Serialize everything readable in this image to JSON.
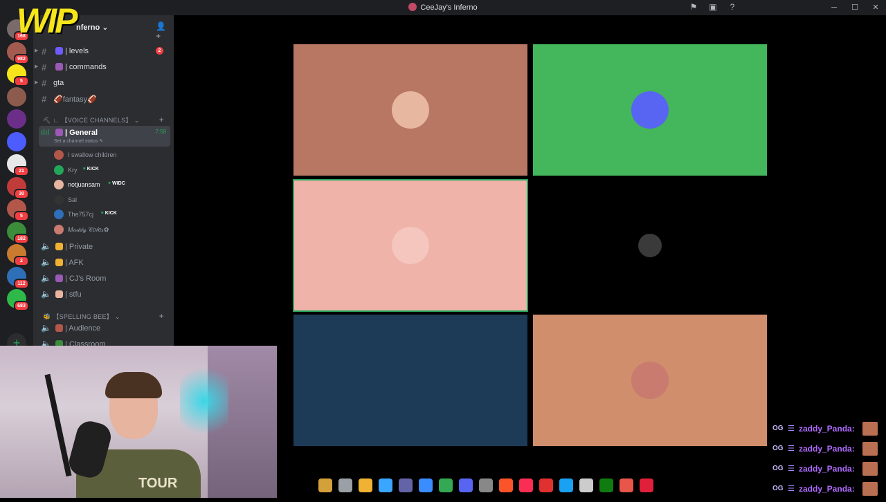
{
  "window": {
    "title": "CeeJay's Inferno",
    "icons": [
      "inbox-icon",
      "screen-share-icon",
      "help-icon"
    ],
    "controls": [
      "minimize",
      "maximize",
      "close"
    ]
  },
  "server_rail": {
    "servers": [
      {
        "name": "server-1",
        "color": "#7a6a6a",
        "badge": "168"
      },
      {
        "name": "server-2",
        "color": "#a35a4f",
        "badge": "982"
      },
      {
        "name": "server-wip",
        "color": "#f5e51a",
        "badge": "5"
      },
      {
        "name": "server-4",
        "color": "#8c5b4e",
        "badge": ""
      },
      {
        "name": "server-5",
        "color": "#6b2f8a",
        "badge": ""
      },
      {
        "name": "server-6",
        "color": "#4d5cff",
        "badge": ""
      },
      {
        "name": "server-7",
        "color": "#e8e8e8",
        "badge": "21"
      },
      {
        "name": "server-8",
        "color": "#c13b3b",
        "badge": "30"
      },
      {
        "name": "server-9",
        "color": "#b2574a",
        "badge": "5"
      },
      {
        "name": "server-10",
        "color": "#3b8c3b",
        "badge": "182"
      },
      {
        "name": "server-11",
        "color": "#c97b2f",
        "badge": "2"
      },
      {
        "name": "server-12",
        "color": "#2f6fb8",
        "badge": "112"
      },
      {
        "name": "server-13",
        "color": "#2fb84a",
        "badge": "683"
      }
    ],
    "add_server_label": "+"
  },
  "sidebar": {
    "server_name": "nferno",
    "channels_top": [
      {
        "name": "| levels",
        "mention": "2",
        "emoji_color": "#6d5cff"
      },
      {
        "name": "| commands",
        "mention": "",
        "emoji_color": "#9b59b6"
      },
      {
        "name": "gta",
        "mention": "",
        "emoji_color": ""
      },
      {
        "name": "🏈fantasy🏈",
        "mention": "",
        "emoji_color": ""
      }
    ],
    "voice_category": "【VOICE CHANNELS】",
    "general": {
      "name": "| General",
      "time": "7:58",
      "status": "Set a channel status"
    },
    "voice_members": [
      {
        "name": "I swallow children",
        "avatar": "#b2574a",
        "tag": ""
      },
      {
        "name": "Kry",
        "avatar": "#23a55a",
        "tag": "KICK"
      },
      {
        "name": "notjuansam",
        "avatar": "#e7b4a0",
        "tag": "WIDC"
      },
      {
        "name": "Sal",
        "avatar": "#333333",
        "tag": ""
      },
      {
        "name": "The757cj",
        "avatar": "#2f6fb8",
        "tag": "KICK"
      },
      {
        "name": "𝑀𝒶𝒹𝒹𝓎 𝒞𝑜𝓁𝑒𝓈✿",
        "avatar": "#c97b6f",
        "tag": ""
      }
    ],
    "other_voice": [
      {
        "name": "| Private",
        "emoji_color": "#f0b232"
      },
      {
        "name": "| AFK",
        "emoji_color": "#f0b232"
      },
      {
        "name": "| CJ's Room",
        "emoji_color": "#9b59b6"
      },
      {
        "name": "| stfu",
        "emoji_color": "#e7b4a0"
      }
    ],
    "spelling_category": "【SPELLING BEE】",
    "spelling_channels": [
      {
        "name": "| Audience",
        "emoji_color": "#b2574a"
      },
      {
        "name": "| Classroom",
        "emoji_color": "#3b8c3b"
      }
    ]
  },
  "video_tiles": [
    {
      "name": "tile-1",
      "bg": "#b87763",
      "avatar": "#e8b7a0",
      "speaking": false
    },
    {
      "name": "tile-2",
      "bg": "#44b65c",
      "avatar": "#5865f2",
      "speaking": false
    },
    {
      "name": "tile-3",
      "bg": "#efb3aa",
      "avatar": "#f4c6bd",
      "speaking": true
    },
    {
      "name": "tile-4",
      "bg": "#000000",
      "avatar": "#3a3a3a",
      "speaking": false
    },
    {
      "name": "tile-5",
      "bg": "#1d3b56",
      "avatar": "#1d3b56",
      "speaking": false
    },
    {
      "name": "tile-6",
      "bg": "#d08e6c",
      "avatar": "#c97b6f",
      "speaking": false
    }
  ],
  "webcam": {
    "overlay_logo": "WIP",
    "shirt_text": "TOUR"
  },
  "taskbar_icons": [
    {
      "name": "app-1",
      "color": "#d4a03a"
    },
    {
      "name": "app-2",
      "color": "#9aa0a6"
    },
    {
      "name": "file-explorer",
      "color": "#f0b232"
    },
    {
      "name": "copilot",
      "color": "#3aa6ff"
    },
    {
      "name": "teams",
      "color": "#6264a7"
    },
    {
      "name": "store",
      "color": "#3a8cff"
    },
    {
      "name": "chrome",
      "color": "#34a853"
    },
    {
      "name": "discord",
      "color": "#5865f2"
    },
    {
      "name": "app-9",
      "color": "#888888"
    },
    {
      "name": "brave",
      "color": "#fb542b"
    },
    {
      "name": "itunes",
      "color": "#fa2d55"
    },
    {
      "name": "app-12",
      "color": "#e03030"
    },
    {
      "name": "app-13",
      "color": "#1aa1f2"
    },
    {
      "name": "app-14",
      "color": "#cccccc"
    },
    {
      "name": "xbox",
      "color": "#107c10"
    },
    {
      "name": "app-16",
      "color": "#e8554a"
    },
    {
      "name": "obs",
      "color": "#e0203a"
    }
  ],
  "chat": [
    {
      "user": "zaddy_Panda:",
      "badge": "OG"
    },
    {
      "user": "zaddy_Panda:",
      "badge": "OG"
    },
    {
      "user": "zaddy_Panda:",
      "badge": "OG"
    },
    {
      "user": "zaddy_Panda:",
      "badge": "OG"
    }
  ]
}
